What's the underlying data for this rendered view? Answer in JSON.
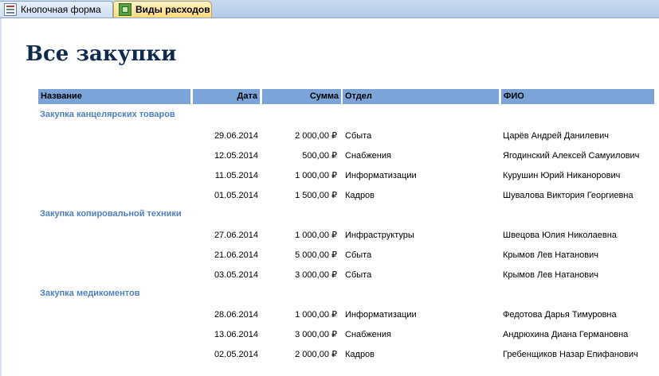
{
  "tabs": [
    {
      "label": "Кнопочная форма",
      "icon": "form-icon",
      "active": false
    },
    {
      "label": "Виды расходов",
      "icon": "report-icon",
      "active": true
    }
  ],
  "report": {
    "title": "Все закупки",
    "columns": {
      "name": "Название",
      "date": "Дата",
      "sum": "Сумма",
      "dept": "Отдел",
      "fio": "ФИО"
    },
    "groups": [
      {
        "name": "Закупка канцелярских товаров",
        "rows": [
          {
            "date": "29.06.2014",
            "sum": "2 000,00 ₽",
            "dept": "Сбыта",
            "fio": "Царёв Андрей Данилевич"
          },
          {
            "date": "12.05.2014",
            "sum": "500,00 ₽",
            "dept": "Снабжения",
            "fio": "Ягодинский Алексей Самуилович"
          },
          {
            "date": "11.05.2014",
            "sum": "1 000,00 ₽",
            "dept": "Информатизации",
            "fio": "Курушин Юрий Никанорович"
          },
          {
            "date": "01.05.2014",
            "sum": "1 500,00 ₽",
            "dept": "Кадров",
            "fio": "Шувалова Виктория Георгиевна"
          }
        ]
      },
      {
        "name": "Закупка копировальной техники",
        "rows": [
          {
            "date": "27.06.2014",
            "sum": "1 000,00 ₽",
            "dept": "Инфраструктуры",
            "fio": "Швецова Юлия Николаевна"
          },
          {
            "date": "21.06.2014",
            "sum": "5 000,00 ₽",
            "dept": "Сбыта",
            "fio": "Крымов Лев Натанович"
          },
          {
            "date": "03.05.2014",
            "sum": "3 000,00 ₽",
            "dept": "Сбыта",
            "fio": "Крымов Лев Натанович"
          }
        ]
      },
      {
        "name": "Закупка медикоментов",
        "rows": [
          {
            "date": "28.06.2014",
            "sum": "1 000,00 ₽",
            "dept": "Информатизации",
            "fio": "Федотова Дарья Тимуровна"
          },
          {
            "date": "13.06.2014",
            "sum": "3 000,00 ₽",
            "dept": "Снабжения",
            "fio": "Андрюхина Диана Германовна"
          },
          {
            "date": "02.05.2014",
            "sum": "2 000,00 ₽",
            "dept": "Кадров",
            "fio": "Гребенщиков Назар Епифанович"
          }
        ]
      }
    ]
  }
}
